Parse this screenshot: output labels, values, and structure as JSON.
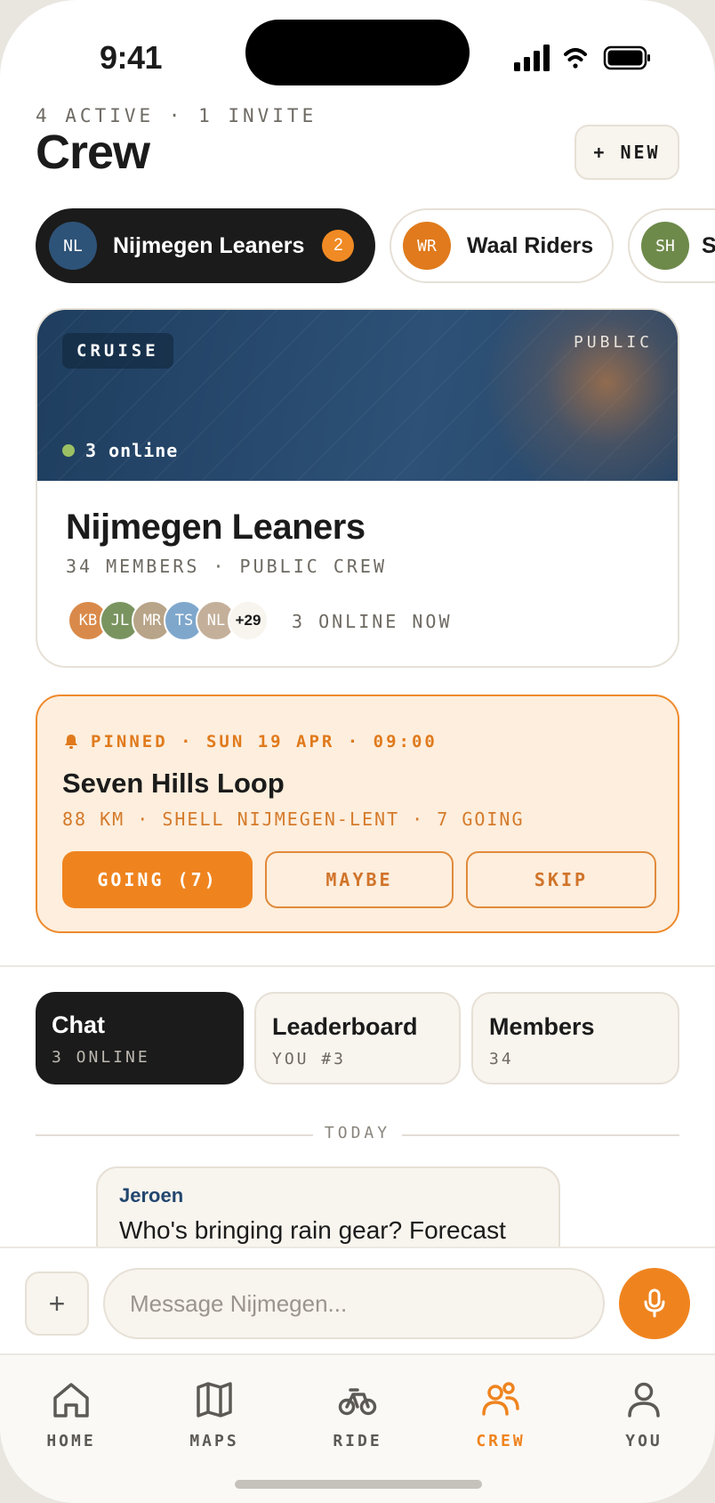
{
  "status_bar": {
    "time": "9:41"
  },
  "header": {
    "subtitle": "4 ACTIVE · 1 INVITE",
    "title": "Crew",
    "new_button": "+ NEW"
  },
  "crews": [
    {
      "initials": "NL",
      "name": "Nijmegen Leaners",
      "badge": "2",
      "avatar_color": "#2e5378",
      "active": true
    },
    {
      "initials": "WR",
      "name": "Waal Riders",
      "avatar_color": "#e07a1c",
      "active": false
    },
    {
      "initials": "SH",
      "name": "S",
      "avatar_color": "#6e8a4a",
      "active": false
    }
  ],
  "crew_card": {
    "tag": "CRUISE",
    "visibility": "PUBLIC",
    "online_status": "3 online",
    "name": "Nijmegen Leaners",
    "meta": "34 MEMBERS · PUBLIC CREW",
    "member_avatars": [
      {
        "initials": "KB",
        "color": "#d98a4a"
      },
      {
        "initials": "JL",
        "color": "#7a9460"
      },
      {
        "initials": "MR",
        "color": "#b8a488"
      },
      {
        "initials": "TS",
        "color": "#7fa7cc"
      },
      {
        "initials": "NL",
        "color": "#c4b09a"
      }
    ],
    "more_members": "+29",
    "online_now": "3 ONLINE NOW"
  },
  "pinned_ride": {
    "label": "PINNED · SUN 19 APR · 09:00",
    "title": "Seven Hills Loop",
    "meta": "88 KM · SHELL NIJMEGEN-LENT · 7 GOING",
    "going_button": "GOING (7)",
    "maybe_button": "MAYBE",
    "skip_button": "SKIP"
  },
  "tabs": [
    {
      "label": "Chat",
      "sub": "3 ONLINE"
    },
    {
      "label": "Leaderboard",
      "sub": "YOU #3"
    },
    {
      "label": "Members",
      "sub": "34"
    }
  ],
  "chat": {
    "date_divider": "TODAY",
    "messages": [
      {
        "author": "Jeroen",
        "text": "Who's bringing rain gear? Forecast"
      }
    ]
  },
  "composer": {
    "attach_label": "+",
    "placeholder": "Message Nijmegen..."
  },
  "nav": [
    {
      "label": "HOME",
      "icon": "home-icon"
    },
    {
      "label": "MAPS",
      "icon": "map-icon"
    },
    {
      "label": "RIDE",
      "icon": "bike-icon"
    },
    {
      "label": "CREW",
      "icon": "crew-icon",
      "active": true
    },
    {
      "label": "YOU",
      "icon": "user-icon"
    }
  ],
  "colors": {
    "accent": "#ef841f",
    "dark": "#1b1b1b",
    "navy": "#22466e"
  }
}
